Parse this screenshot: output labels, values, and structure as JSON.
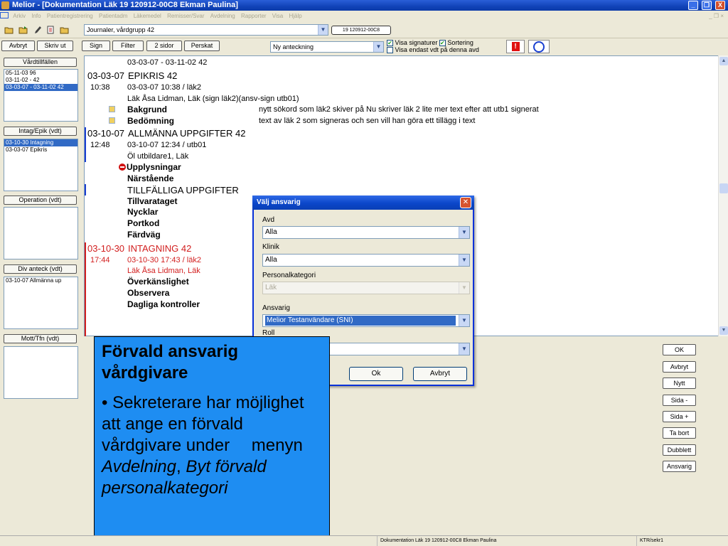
{
  "window": {
    "title": "Melior - [Dokumentation Läk 19 120912-00C8 Ekman Paulina]",
    "minimize": "_",
    "maximize": "❐",
    "close": "X"
  },
  "menu": [
    "Arkiv",
    "Info",
    "Patientregistrering",
    "Patientadm",
    "Läkemedel",
    "Remisser/Svar",
    "Avdelning",
    "Rapporter",
    "Visa",
    "Hjälp"
  ],
  "toolbar": {
    "view_select": "Journaler, vårdgrupp 42",
    "patient_id": "19 120912-00C8"
  },
  "buttons": {
    "abort": "Avbryt",
    "print": "Skriv ut",
    "sign": "Sign",
    "filter": "Filter",
    "two_pages": "2 sidor",
    "perskat": "Perskat",
    "new_note_select": "Ny anteckning",
    "show_signatures": "Visa signaturer",
    "sorting": "Sortering",
    "show_only_unit": "Visa endast vdt på denna avd",
    "alert": "!",
    "circle": "O"
  },
  "left_panel": {
    "sections": [
      {
        "header": "Vårdtillfällen",
        "rows": [
          {
            "text": "05-11-03      96"
          },
          {
            "text": "03-11-02 -      42"
          },
          {
            "text": "03-03-07 - 03-11-02 42",
            "selected": true
          }
        ]
      },
      {
        "header": "Intag/Epik (vdt)",
        "rows": [
          {
            "text": "03-10-30  Intagning",
            "selected": true
          },
          {
            "text": "03-03-07  Epikris"
          }
        ]
      },
      {
        "header": "Operation (vdt)",
        "rows": []
      },
      {
        "header": "Div anteck (vdt)",
        "rows": [
          {
            "text": "03-10-07  Allmänna up"
          }
        ]
      },
      {
        "header": "Mott/Tfn (vdt)",
        "rows": []
      }
    ]
  },
  "journal": {
    "range": "03-03-07 - 03-11-02  42",
    "entries": {
      "epikris": {
        "date": "03-03-07",
        "title": "EPIKRIS    42",
        "time": "10:38",
        "stamp": "03-03-07 10:38 / läk2",
        "author": "Läk Åsa Lidman, Läk (sign läk2)(ansv-sign utb01)",
        "kw1": "Bakgrund",
        "kw1_text": "nytt sökord som läk2 skiver på Nu skriver läk 2 lite mer text efter att utb1 signerat",
        "kw2": "Bedömning",
        "kw2_text": "text av läk 2 som signeras och sen vill han göra ett tillägg i text"
      },
      "allmanna": {
        "date": "03-10-07",
        "title": "ALLMÄNNA UPPGIFTER    42",
        "time": "12:48",
        "stamp": "03-10-07 12:34 / utb01",
        "author": "Öl utbildare1, Läk",
        "kws": [
          "Upplysningar",
          "Närstående"
        ],
        "sub_heading": "TILLFÄLLIGA UPPGIFTER",
        "kws2": [
          "Tillvarataget",
          "Nycklar",
          "Portkod",
          "Färdväg"
        ]
      },
      "intagning": {
        "date": "03-10-30",
        "title": "INTAGNING    42",
        "time": "17:44",
        "stamp": "03-10-30 17:43 / läk2",
        "author": "Läk Åsa Lidman, Läk",
        "kws": [
          "Överkänslighet",
          "Observera",
          "Dagliga kontroller"
        ]
      }
    }
  },
  "dialog": {
    "title": "Välj ansvarig",
    "avd_label": "Avd",
    "avd_value": "Alla",
    "klinik_label": "Klinik",
    "klinik_value": "Alla",
    "personal_label": "Personalkategori",
    "personal_value": "Läk",
    "ansvarig_label": "Ansvarig",
    "ansvarig_value": "Melior Testanvändare (SNI)",
    "roll_label": "Roll",
    "ok": "Ok",
    "cancel": "Avbryt"
  },
  "right_buttons": [
    "OK",
    "Avbryt",
    "Nytt",
    "Sida -",
    "Sida +",
    "Ta bort",
    "Dubblett",
    "Ansvarig"
  ],
  "callout": {
    "heading": "Förvald ansvarig vårdgivare",
    "bullet": "•",
    "text_1": "Sekreterare har möjlighet att    ange en förvald vårdgivare under",
    "text_2": "menyn",
    "italic_1": "Avdelning",
    "comma": ",",
    "italic_2": "Byt förvald personalkategori"
  },
  "status": {
    "center": "Dokumentation Läk 19 120912-00C8 Ekman Paulina",
    "right": "KTR/sekr1"
  },
  "colors": {
    "titlebar": "#1143b8",
    "selection": "#316ac5",
    "callout": "#1e8df2",
    "red_entry": "#d21e1e"
  }
}
